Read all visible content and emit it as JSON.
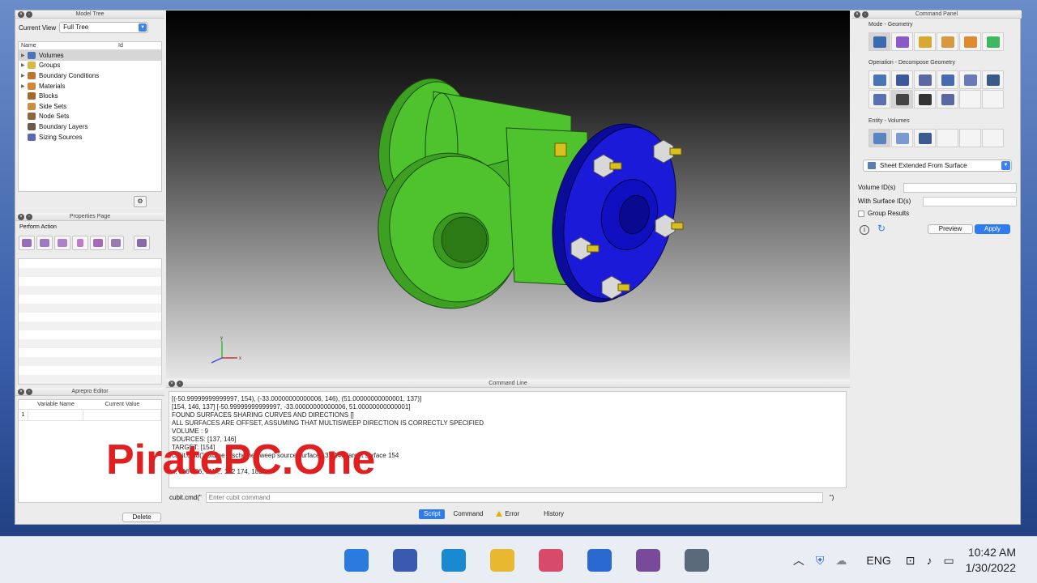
{
  "model_tree": {
    "title": "Model Tree",
    "current_view_label": "Current View",
    "current_view_value": "Full Tree",
    "col_name": "Name",
    "col_id": "Id",
    "items": [
      {
        "label": "Volumes",
        "color": "#4a74b4",
        "expand": "▶"
      },
      {
        "label": "Groups",
        "color": "#d8b840",
        "expand": "▶"
      },
      {
        "label": "Boundary Conditions",
        "color": "#b87830",
        "expand": "▶"
      },
      {
        "label": "Materials",
        "color": "#d08838",
        "expand": "▶"
      },
      {
        "label": "Blocks",
        "color": "#a06a28",
        "expand": ""
      },
      {
        "label": "Side Sets",
        "color": "#c89040",
        "expand": ""
      },
      {
        "label": "Node Sets",
        "color": "#8a6a3a",
        "expand": ""
      },
      {
        "label": "Boundary Layers",
        "color": "#6a5a4a",
        "expand": ""
      },
      {
        "label": "Sizing Sources",
        "color": "#5a6ab0",
        "expand": ""
      }
    ]
  },
  "properties": {
    "title": "Properties Page",
    "perform_action": "Perform Action"
  },
  "aprepro": {
    "title": "Aprepro Editor",
    "col_variable": "Variable Name",
    "col_value": "Current Value",
    "row_number": "1",
    "delete_label": "Delete"
  },
  "command_line": {
    "title": "Command Line",
    "output_lines": [
      "[(-50.99999999999997, 154), (-33.00000000000006, 146), (51.00000000000001, 137)]",
      "[154, 146, 137] [-50.99999999999997, -33.00000000000006, 51.00000000000001]",
      "FOUND SURFACES SHARING CURVES AND DIRECTIONS []",
      "ALL SURFACES ARE OFFSET, ASSUMING THAT MULTISWEEP DIRECTION IS CORRECTLY SPECIFIED",
      "VOLUME :  9",
      "SOURCES:  [137, 146]",
      "TARGET:  [154]",
      "cubit.cmd(\"volume 9 scheme sweep source surface 137 146 target surface 154",
      "",
      "... 116 166, 111 ... 172 174, 182 ..."
    ],
    "prompt": "cubit.cmd(\"",
    "input_placeholder": "Enter cubit command",
    "closing": "\")",
    "tabs": {
      "script": "Script",
      "command": "Command",
      "error": "Error",
      "history": "History"
    }
  },
  "command_panel": {
    "title": "Command Panel",
    "mode_label": "Mode - Geometry",
    "operation_label": "Operation - Decompose Geometry",
    "entity_label": "Entity - Volumes",
    "mode_icons": [
      {
        "name": "geometry-mode-icon",
        "color": "#3a6ab0"
      },
      {
        "name": "mesh-mode-icon",
        "color": "#8a5ac8"
      },
      {
        "name": "blocks-mode-icon",
        "color": "#d8a830"
      },
      {
        "name": "bc-mode-icon",
        "color": "#d89840"
      },
      {
        "name": "materials-mode-icon",
        "color": "#e08a30"
      },
      {
        "name": "analysis-mode-icon",
        "color": "#40b860"
      }
    ],
    "operation_icons": [
      {
        "name": "webcut-icon",
        "color": "#4a74b4"
      },
      {
        "name": "split-surface-icon",
        "color": "#3a5a9a"
      },
      {
        "name": "imprint-icon",
        "color": "#5a6aa0"
      },
      {
        "name": "merge-icon",
        "color": "#4a6ab0"
      },
      {
        "name": "unite-icon",
        "color": "#6a7ab8"
      },
      {
        "name": "tweak-icon",
        "color": "#3a5a8a"
      },
      {
        "name": "partition-icon",
        "color": "#5a70b0"
      },
      {
        "name": "scissors-icon",
        "color": "#444444"
      },
      {
        "name": "list-icon",
        "color": "#333333"
      },
      {
        "name": "cross-tools-icon",
        "color": "#5a6aa0"
      },
      {
        "name": "empty-icon",
        "color": "transparent"
      },
      {
        "name": "empty-icon",
        "color": "transparent"
      }
    ],
    "entity_icons": [
      {
        "name": "volume-entity-icon",
        "color": "#5a84c0"
      },
      {
        "name": "surface-entity-icon",
        "color": "#7a9ad0"
      },
      {
        "name": "curve-entity-icon",
        "color": "#3a5a90"
      },
      {
        "name": "empty-icon",
        "color": "transparent"
      },
      {
        "name": "empty-icon",
        "color": "transparent"
      },
      {
        "name": "empty-icon",
        "color": "transparent"
      }
    ],
    "method_select": "Sheet Extended From Surface",
    "volume_ids_label": "Volume ID(s)",
    "surface_ids_label": "With Surface ID(s)",
    "group_results_label": "Group Results",
    "preview_label": "Preview",
    "apply_label": "Apply"
  },
  "viewport": {
    "pipe_color": "#4fc32e",
    "flange_color": "#1a1ad8",
    "axis_labels": {
      "x": "x",
      "y": "y"
    }
  },
  "watermark": "PiratePC.One",
  "taskbar": {
    "apps": [
      {
        "name": "start-icon",
        "color": "#2a7ae0"
      },
      {
        "name": "task-view-icon",
        "color": "#3a5ab0"
      },
      {
        "name": "edge-icon",
        "color": "#1a8ad0"
      },
      {
        "name": "file-explorer-icon",
        "color": "#e8b830"
      },
      {
        "name": "store-icon",
        "color": "#d84a6a"
      },
      {
        "name": "mail-icon",
        "color": "#2a6ad0"
      },
      {
        "name": "cubit-app-icon",
        "color": "#7a4a9a"
      },
      {
        "name": "settings-icon",
        "color": "#5a6a7a"
      }
    ],
    "language": "ENG",
    "time": "10:42 AM",
    "date": "1/30/2022"
  }
}
